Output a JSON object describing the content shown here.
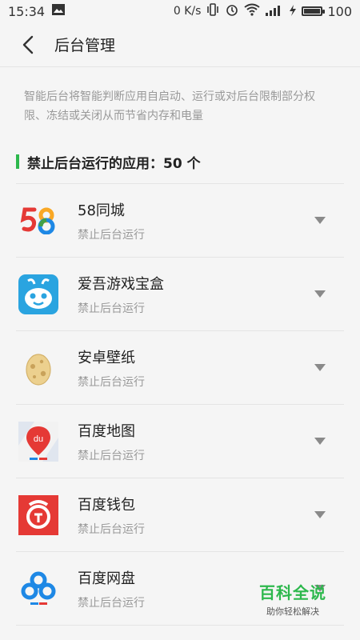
{
  "status_bar": {
    "time": "15:34",
    "speed": "0 K/s",
    "battery": "100"
  },
  "header": {
    "title": "后台管理"
  },
  "description": "智能后台将智能判断应用自启动、运行或对后台限制部分权限、冻结或关闭从而节省内存和电量",
  "section": {
    "title": "禁止后台运行的应用：50 个"
  },
  "apps": [
    {
      "name": "58同城",
      "status": "禁止后台运行",
      "icon": "58-logo-icon"
    },
    {
      "name": "爱吾游戏宝盒",
      "status": "禁止后台运行",
      "icon": "game-box-icon"
    },
    {
      "name": "安卓壁纸",
      "status": "禁止后台运行",
      "icon": "egg-icon"
    },
    {
      "name": "百度地图",
      "status": "禁止后台运行",
      "icon": "map-pin-icon"
    },
    {
      "name": "百度钱包",
      "status": "禁止后台运行",
      "icon": "wallet-icon"
    },
    {
      "name": "百度网盘",
      "status": "禁止后台运行",
      "icon": "cloud-icon"
    }
  ],
  "watermark": {
    "title": "百科全说",
    "subtitle": "助你轻松解决"
  },
  "colors": {
    "accent_green": "#2db84d"
  }
}
